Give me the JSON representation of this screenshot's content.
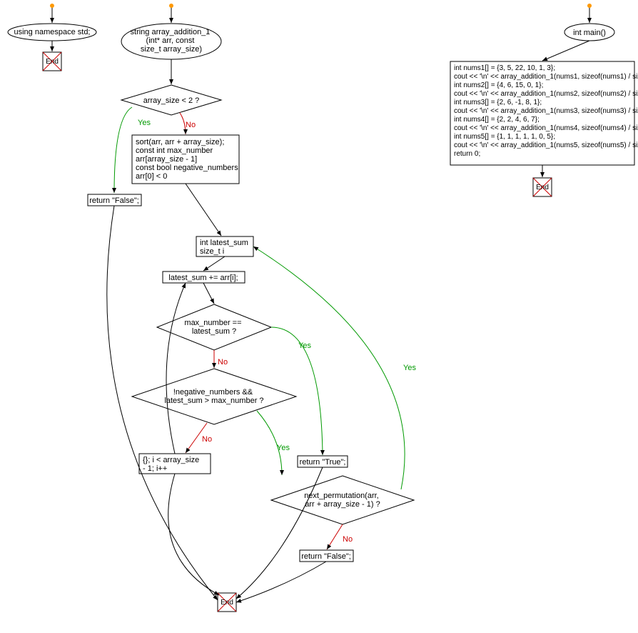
{
  "flowchart1": {
    "start_label": "using namespace std;",
    "end_label": "End"
  },
  "flowchart2": {
    "start_label": "string array_addition_1\n(int* arr, const\nsize_t array_size)",
    "decision1": "array_size < 2 ?",
    "process1": "sort(arr, arr + array_size);\nconst int max_number\narr[array_size - 1]\nconst bool negative_numbers\narr[0] < 0",
    "return_false1": "return \"False\";",
    "process2": "int latest_sum\nsize_t i",
    "process3": "latest_sum += arr[i];",
    "decision2": "max_number ==\nlatest_sum ?",
    "decision3": "!negative_numbers &&\nlatest_sum > max_number ?",
    "process4": "{}; i < array_size\n- 1; i++",
    "return_true": "return \"True\";",
    "decision4": "next_permutation(arr,\narr + array_size - 1) ?",
    "return_false2": "return \"False\";",
    "end_label": "End",
    "yes": "Yes",
    "no": "No"
  },
  "flowchart3": {
    "start_label": "int main()",
    "code": "int nums1[] = {3, 5, 22, 10, 1, 3};\ncout << '\\n' << array_addition_1(nums1, sizeof(nums1) / sizeof(nums1[0]));\nint nums2[] = {4, 6, 15, 0, 1};\ncout << '\\n' << array_addition_1(nums2, sizeof(nums2) / sizeof(nums2[0]));\nint nums3[] = {2, 6, -1, 8, 1};\ncout << '\\n' << array_addition_1(nums3, sizeof(nums3) / sizeof(nums3[0]));\nint nums4[] = {2, 2, 4, 6, 7};\ncout << '\\n' << array_addition_1(nums4, sizeof(nums4) / sizeof(nums4[0]));\nint nums5[] = {1, 1, 1, 1, 1, 0, 5};\ncout << '\\n' << array_addition_1(nums5, sizeof(nums5) / sizeof(nums5[0]));\nreturn 0;",
    "end_label": "End"
  }
}
